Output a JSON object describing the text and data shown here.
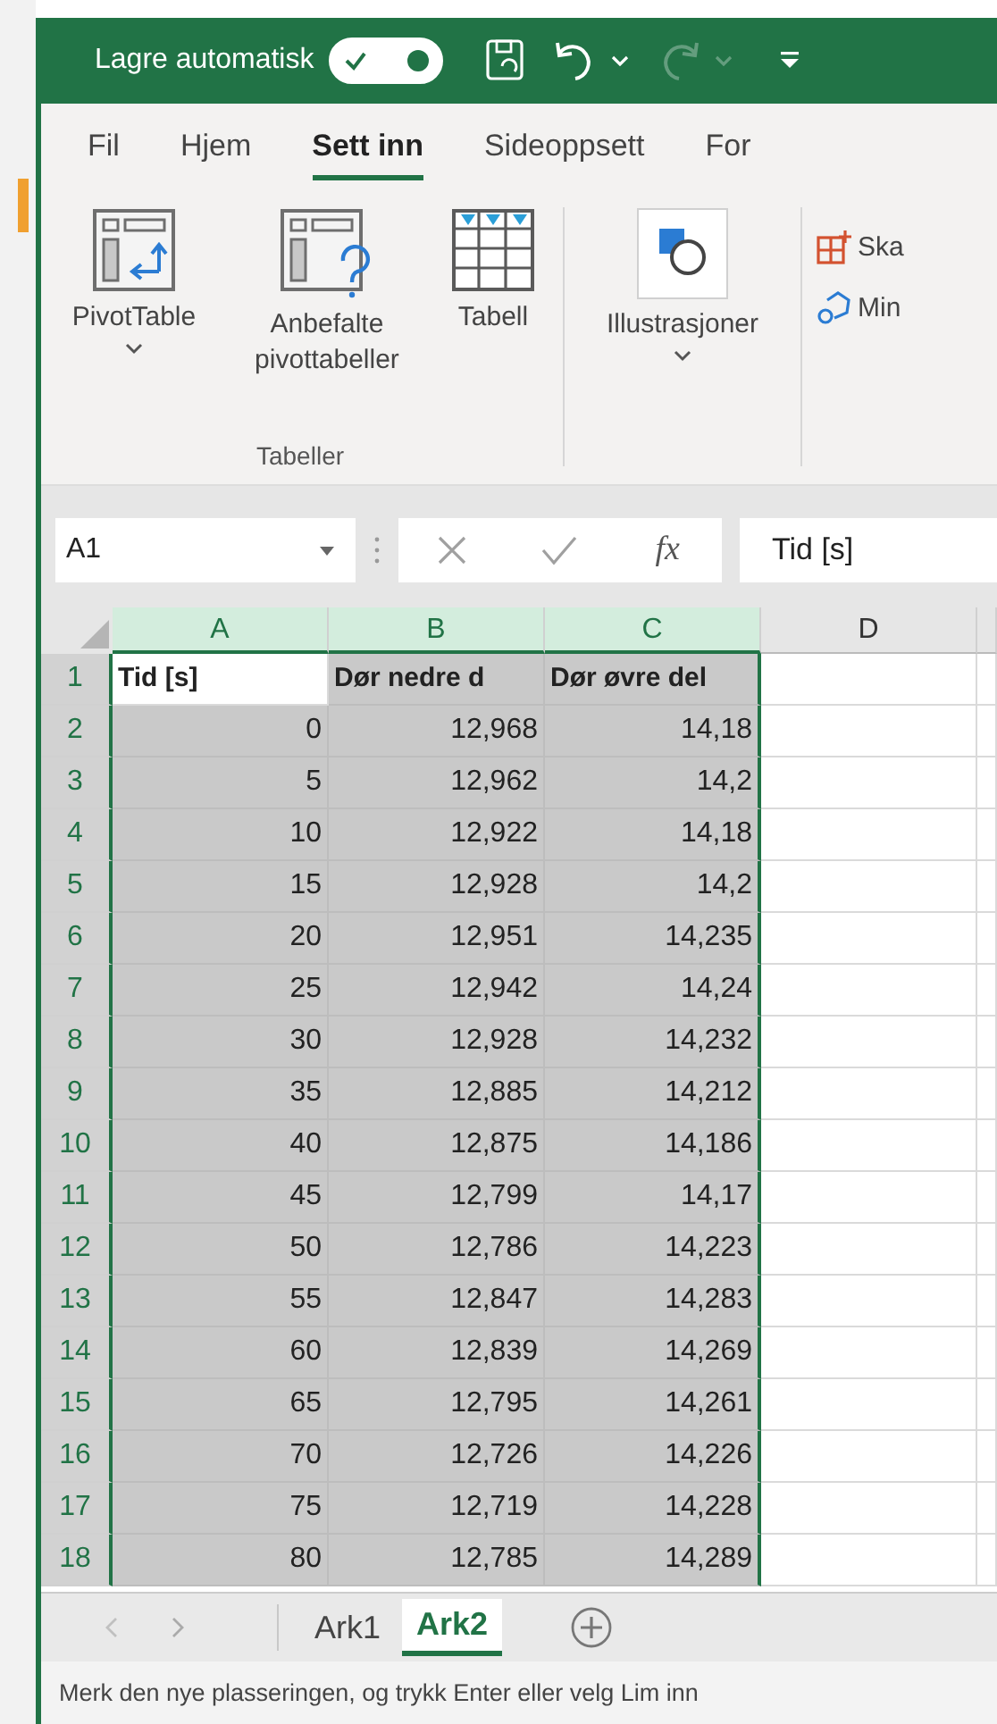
{
  "title_bar": {
    "autosave_label": "Lagre automatisk",
    "autosave_on": true,
    "redo_disabled": true
  },
  "ribbon_tabs": [
    {
      "label": "Fil",
      "selected": false
    },
    {
      "label": "Hjem",
      "selected": false
    },
    {
      "label": "Sett inn",
      "selected": true
    },
    {
      "label": "Sideoppsett",
      "selected": false
    },
    {
      "label": "For",
      "selected": false
    }
  ],
  "ribbon_groups": [
    {
      "label": "Tabeller",
      "buttons": [
        {
          "kind": "pivot",
          "label": "PivotTable",
          "dropdown": true
        },
        {
          "kind": "recommended",
          "label": "Anbefalte pivottabeller",
          "dropdown": false
        },
        {
          "kind": "table",
          "label": "Tabell",
          "dropdown": false
        }
      ]
    },
    {
      "buttons": [
        {
          "kind": "illustrations",
          "label": "Illustrasjoner",
          "dropdown": true
        }
      ]
    },
    {
      "buttons": [
        {
          "kind": "addin",
          "label": "Ska"
        },
        {
          "kind": "mine",
          "label": "Min"
        }
      ]
    }
  ],
  "formula_bar": {
    "name_box": "A1",
    "function_symbol": "fx",
    "value": "Tid [s]"
  },
  "columns": [
    {
      "label": "A",
      "selected": true
    },
    {
      "label": "B",
      "selected": true
    },
    {
      "label": "C",
      "selected": true
    },
    {
      "label": "D",
      "selected": false
    }
  ],
  "rows": [
    {
      "number": "1",
      "cells": [
        {
          "text": "Tid [s]",
          "selected": false
        },
        {
          "text": "Dør nedre d",
          "selected": true
        },
        {
          "text": "Dør øvre del",
          "selected": true
        }
      ]
    },
    {
      "number": "2",
      "cells": [
        {
          "text": "0",
          "selected": true
        },
        {
          "text": "12,968",
          "selected": true
        },
        {
          "text": "14,18",
          "selected": true
        }
      ]
    },
    {
      "number": "3",
      "cells": [
        {
          "text": "5",
          "selected": true
        },
        {
          "text": "12,962",
          "selected": true
        },
        {
          "text": "14,2",
          "selected": true
        }
      ]
    },
    {
      "number": "4",
      "cells": [
        {
          "text": "10",
          "selected": true
        },
        {
          "text": "12,922",
          "selected": true
        },
        {
          "text": "14,18",
          "selected": true
        }
      ]
    },
    {
      "number": "5",
      "cells": [
        {
          "text": "15",
          "selected": true
        },
        {
          "text": "12,928",
          "selected": true
        },
        {
          "text": "14,2",
          "selected": true
        }
      ]
    },
    {
      "number": "6",
      "cells": [
        {
          "text": "20",
          "selected": true
        },
        {
          "text": "12,951",
          "selected": true
        },
        {
          "text": "14,235",
          "selected": true
        }
      ]
    },
    {
      "number": "7",
      "cells": [
        {
          "text": "25",
          "selected": true
        },
        {
          "text": "12,942",
          "selected": true
        },
        {
          "text": "14,24",
          "selected": true
        }
      ]
    },
    {
      "number": "8",
      "cells": [
        {
          "text": "30",
          "selected": true
        },
        {
          "text": "12,928",
          "selected": true
        },
        {
          "text": "14,232",
          "selected": true
        }
      ]
    },
    {
      "number": "9",
      "cells": [
        {
          "text": "35",
          "selected": true
        },
        {
          "text": "12,885",
          "selected": true
        },
        {
          "text": "14,212",
          "selected": true
        }
      ]
    },
    {
      "number": "10",
      "cells": [
        {
          "text": "40",
          "selected": true
        },
        {
          "text": "12,875",
          "selected": true
        },
        {
          "text": "14,186",
          "selected": true
        }
      ]
    },
    {
      "number": "11",
      "cells": [
        {
          "text": "45",
          "selected": true
        },
        {
          "text": "12,799",
          "selected": true
        },
        {
          "text": "14,17",
          "selected": true
        }
      ]
    },
    {
      "number": "12",
      "cells": [
        {
          "text": "50",
          "selected": true
        },
        {
          "text": "12,786",
          "selected": true
        },
        {
          "text": "14,223",
          "selected": true
        }
      ]
    },
    {
      "number": "13",
      "cells": [
        {
          "text": "55",
          "selected": true
        },
        {
          "text": "12,847",
          "selected": true
        },
        {
          "text": "14,283",
          "selected": true
        }
      ]
    },
    {
      "number": "14",
      "cells": [
        {
          "text": "60",
          "selected": true
        },
        {
          "text": "12,839",
          "selected": true
        },
        {
          "text": "14,269",
          "selected": true
        }
      ]
    },
    {
      "number": "15",
      "cells": [
        {
          "text": "65",
          "selected": true
        },
        {
          "text": "12,795",
          "selected": true
        },
        {
          "text": "14,261",
          "selected": true
        }
      ]
    },
    {
      "number": "16",
      "cells": [
        {
          "text": "70",
          "selected": true
        },
        {
          "text": "12,726",
          "selected": true
        },
        {
          "text": "14,226",
          "selected": true
        }
      ]
    },
    {
      "number": "17",
      "cells": [
        {
          "text": "75",
          "selected": true
        },
        {
          "text": "12,719",
          "selected": true
        },
        {
          "text": "14,228",
          "selected": true
        }
      ]
    },
    {
      "number": "18",
      "cells": [
        {
          "text": "80",
          "selected": true
        },
        {
          "text": "12,785",
          "selected": true
        },
        {
          "text": "14,289",
          "selected": true
        }
      ]
    }
  ],
  "sheet_tabs": [
    {
      "label": "Ark1",
      "selected": false
    },
    {
      "label": "Ark2",
      "selected": true
    }
  ],
  "status_bar": "Merk den nye plasseringen, og trykk Enter eller velg Lim inn"
}
